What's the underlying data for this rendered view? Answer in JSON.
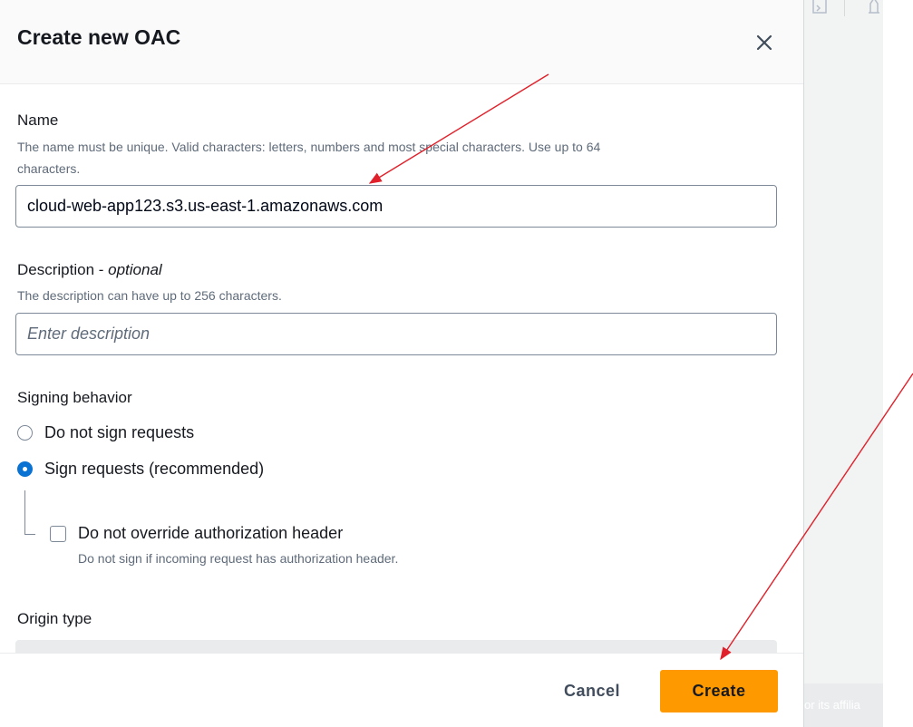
{
  "background": {
    "footer_text": "or its affilia"
  },
  "modal": {
    "title": "Create new OAC",
    "name_field": {
      "label": "Name",
      "hint": "The name must be unique. Valid characters: letters, numbers and most special characters. Use up to 64 characters.",
      "hint_line1": "The name must be unique. Valid characters: letters, numbers and most special characters. Use up to 64",
      "hint_line2": "characters.",
      "value": "cloud-web-app123.s3.us-east-1.amazonaws.com"
    },
    "description_field": {
      "label": "Description - ",
      "label_optional": "optional",
      "hint": "The description can have up to 256 characters.",
      "placeholder": "Enter description"
    },
    "signing_behavior": {
      "label": "Signing behavior",
      "options": [
        {
          "label": "Do not sign requests",
          "selected": false
        },
        {
          "label": "Sign requests (recommended)",
          "selected": true
        }
      ],
      "override_checkbox": {
        "label": "Do not override authorization header",
        "hint": "Do not sign if incoming request has authorization header.",
        "checked": false
      }
    },
    "origin_type": {
      "label": "Origin type"
    },
    "footer": {
      "cancel_label": "Cancel",
      "create_label": "Create"
    }
  },
  "colors": {
    "primary_button": "#ff9900",
    "radio_selected": "#0972d3",
    "annotation_arrow": "#e0202a"
  }
}
